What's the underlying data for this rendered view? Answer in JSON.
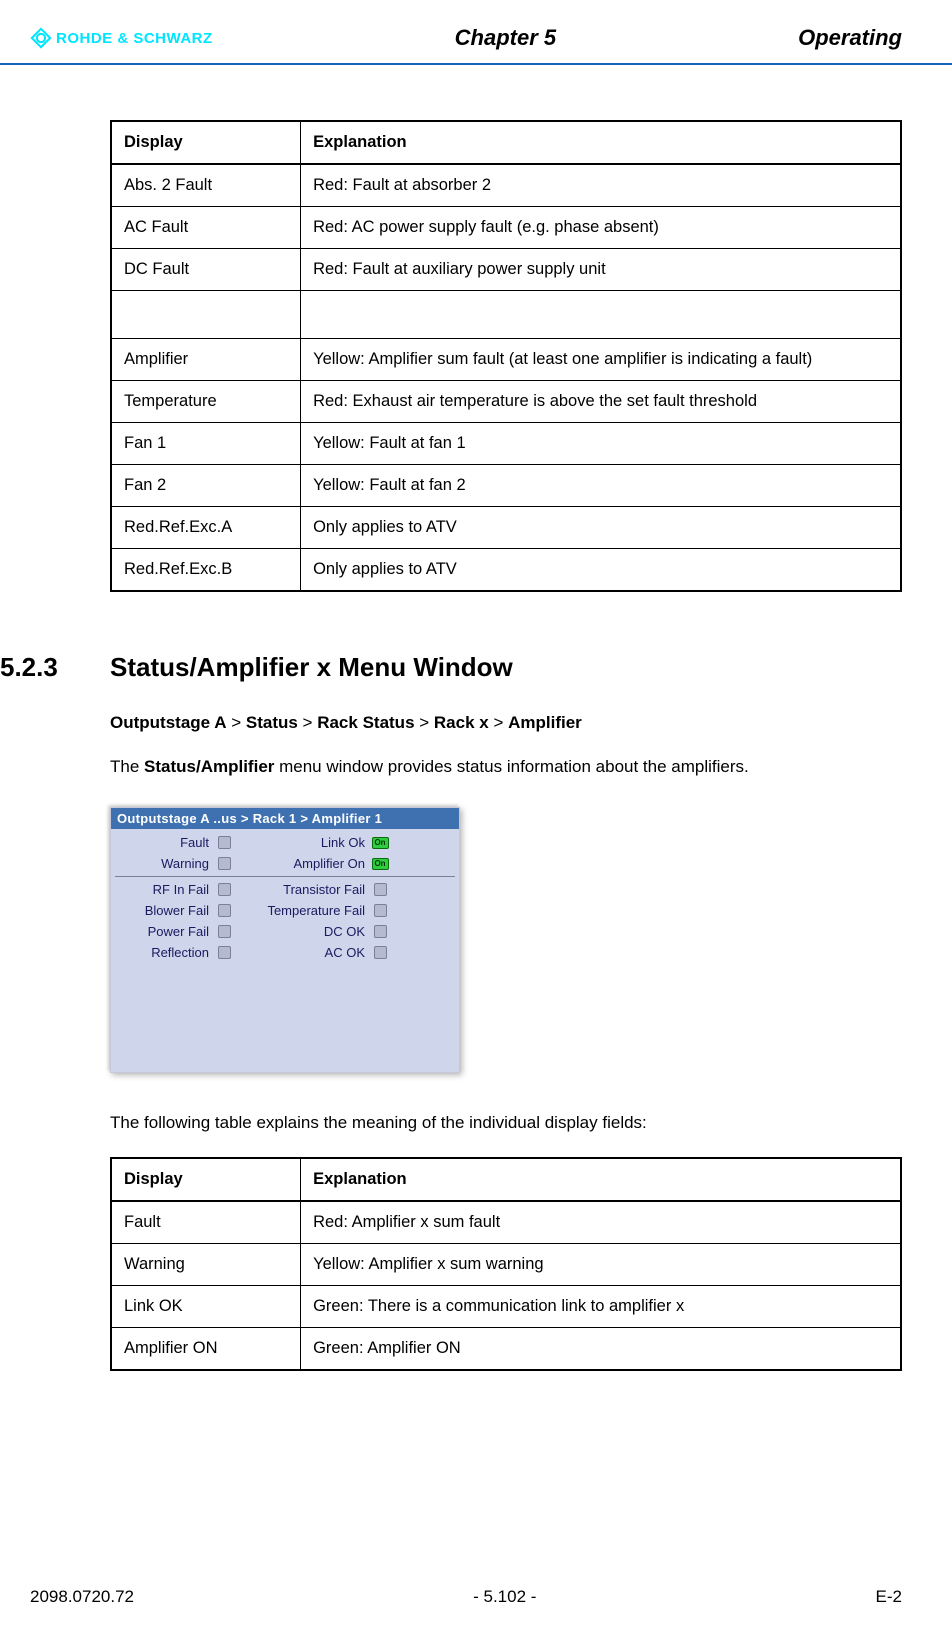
{
  "header": {
    "logo_text": "ROHDE & SCHWARZ",
    "center": "Chapter 5",
    "right": "Operating"
  },
  "table1": {
    "headers": {
      "display": "Display",
      "explanation": "Explanation"
    },
    "rows": [
      {
        "display": "Abs. 2 Fault",
        "explanation": "Red: Fault at absorber 2"
      },
      {
        "display": "AC Fault",
        "explanation": "Red: AC power supply fault (e.g. phase absent)"
      },
      {
        "display": "DC Fault",
        "explanation": "Red: Fault at auxiliary power supply unit"
      },
      {
        "display": "",
        "explanation": ""
      },
      {
        "display": "Amplifier",
        "explanation": "Yellow: Amplifier sum fault (at least one amplifier is indicating a fault)"
      },
      {
        "display": "Temperature",
        "explanation": "Red: Exhaust air temperature is above the set fault threshold"
      },
      {
        "display": "Fan 1",
        "explanation": "Yellow: Fault at fan 1"
      },
      {
        "display": "Fan 2",
        "explanation": "Yellow: Fault at fan 2"
      },
      {
        "display": "Red.Ref.Exc.A",
        "explanation": "Only applies to ATV"
      },
      {
        "display": "Red.Ref.Exc.B",
        "explanation": "Only applies to ATV"
      }
    ]
  },
  "section": {
    "number": "5.2.3",
    "title": "Status/Amplifier x Menu Window",
    "breadcrumb": {
      "p1": "Outputstage A",
      "s": " > ",
      "p2": "Status",
      "p3": "Rack Status",
      "p4": "Rack x",
      "p5": "Amplifier"
    },
    "intro_pre": "The ",
    "intro_bold": "Status/Amplifier",
    "intro_post": " menu window provides status information about the amplifiers."
  },
  "menu": {
    "title": "Outputstage A ..us > Rack 1 > Amplifier 1",
    "on_text": "On",
    "rows_top": [
      {
        "l": "Fault",
        "r": "Link Ok",
        "r_on": true
      },
      {
        "l": "Warning",
        "r": "Amplifier On",
        "r_on": true
      }
    ],
    "rows_bot": [
      {
        "l": "RF In Fail",
        "r": "Transistor Fail"
      },
      {
        "l": "Blower Fail",
        "r": "Temperature Fail"
      },
      {
        "l": "Power Fail",
        "r": "DC OK"
      },
      {
        "l": "Reflection",
        "r": "AC OK"
      }
    ]
  },
  "caption2": "The following table explains the meaning of the individual display fields:",
  "table2": {
    "headers": {
      "display": "Display",
      "explanation": "Explanation"
    },
    "rows": [
      {
        "display": "Fault",
        "explanation": "Red: Amplifier x sum fault"
      },
      {
        "display": "Warning",
        "explanation": "Yellow: Amplifier x sum warning"
      },
      {
        "display": "Link OK",
        "explanation": "Green: There is a communication link to amplifier x"
      },
      {
        "display": "Amplifier ON",
        "explanation": "Green: Amplifier ON"
      }
    ]
  },
  "footer": {
    "left": "2098.0720.72",
    "center": "- 5.102 -",
    "right": "E-2"
  }
}
